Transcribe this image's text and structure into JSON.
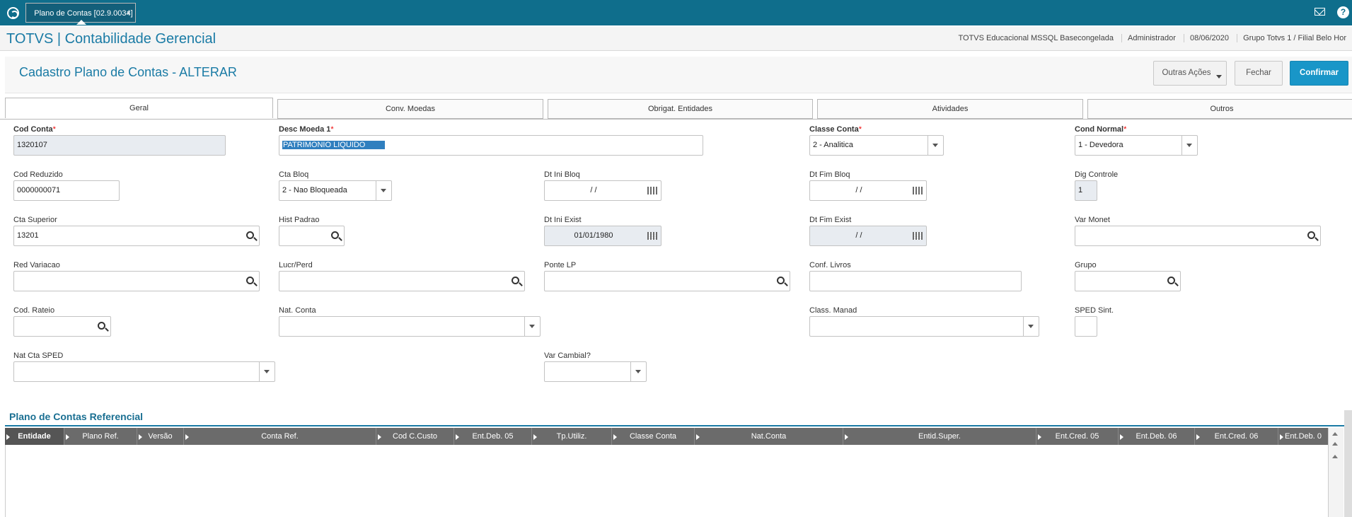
{
  "topbar": {
    "tab_label": "Plano de Contas [02.9.0034]",
    "close_label": "×",
    "help_label": "?"
  },
  "appbar": {
    "title": "TOTVS | Contabilidade Gerencial",
    "info": [
      "TOTVS Educacional MSSQL Basecongelada",
      "Administrador",
      "08/06/2020",
      "Grupo Totvs 1 / Filial Belo Hor"
    ]
  },
  "page": {
    "title": "Cadastro Plano de Contas - ALTERAR",
    "buttons": {
      "outras": "Outras Ações",
      "fechar": "Fechar",
      "confirmar": "Confirmar"
    }
  },
  "tabs": [
    "Geral",
    "Conv. Moedas",
    "Obrigat. Entidades",
    "Atividades",
    "Outros"
  ],
  "form": {
    "cod_conta": {
      "label": "Cod Conta",
      "req": "*",
      "value": "1320107"
    },
    "desc_moeda": {
      "label": "Desc Moeda 1",
      "req": "*",
      "value": "PATRIMONIO LIQUIDO"
    },
    "classe_conta": {
      "label": "Classe Conta",
      "req": "*",
      "value": "2 - Analitica"
    },
    "cond_normal": {
      "label": "Cond Normal",
      "req": "*",
      "value": "1 - Devedora"
    },
    "cod_reduzido": {
      "label": "Cod Reduzido",
      "value": "0000000071"
    },
    "cta_bloq": {
      "label": "Cta Bloq",
      "value": "2 - Nao Bloqueada"
    },
    "dt_ini_bloq": {
      "label": "Dt Ini Bloq",
      "value": "/ /"
    },
    "dt_fim_bloq": {
      "label": "Dt Fim Bloq",
      "value": "/ /"
    },
    "dig_controle": {
      "label": "Dig Controle",
      "value": "1"
    },
    "cta_superior": {
      "label": "Cta Superior",
      "value": "13201"
    },
    "hist_padrao": {
      "label": "Hist Padrao",
      "value": ""
    },
    "dt_ini_exist": {
      "label": "Dt Ini Exist",
      "value": "01/01/1980"
    },
    "dt_fim_exist": {
      "label": "Dt Fim Exist",
      "value": "/ /"
    },
    "var_monet": {
      "label": "Var Monet",
      "value": ""
    },
    "red_variacao": {
      "label": "Red Variacao",
      "value": ""
    },
    "lucr_perd": {
      "label": "Lucr/Perd",
      "value": ""
    },
    "ponte_lp": {
      "label": "Ponte LP",
      "value": ""
    },
    "conf_livros": {
      "label": "Conf. Livros",
      "value": ""
    },
    "grupo": {
      "label": "Grupo",
      "value": ""
    },
    "cod_rateio": {
      "label": "Cod. Rateio",
      "value": ""
    },
    "nat_conta": {
      "label": "Nat. Conta",
      "value": ""
    },
    "class_manad": {
      "label": "Class. Manad",
      "value": ""
    },
    "sped_sint": {
      "label": "SPED Sint.",
      "value": ""
    },
    "nat_cta_sped": {
      "label": "Nat Cta SPED",
      "value": ""
    },
    "var_cambial": {
      "label": "Var Cambial?",
      "value": ""
    }
  },
  "grid": {
    "title": "Plano de Contas Referencial",
    "columns": [
      "Entidade",
      "Plano Ref.",
      "Versão",
      "Conta Ref.",
      "Cod C.Custo",
      "Ent.Deb. 05",
      "Tp.Utiliz.",
      "Classe Conta",
      "Nat.Conta",
      "Entid.Super.",
      "Ent.Cred. 05",
      "Ent.Deb. 06",
      "Ent.Cred. 06",
      "Ent.Deb. 0"
    ]
  }
}
